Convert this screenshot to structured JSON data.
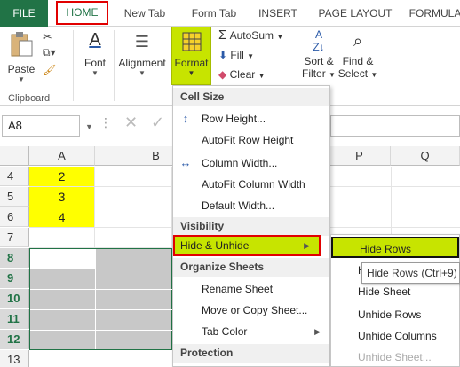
{
  "tabs": [
    "FILE",
    "HOME",
    "New Tab",
    "Form Tab",
    "INSERT",
    "PAGE LAYOUT",
    "FORMULA"
  ],
  "ribbon": {
    "paste": "Paste",
    "clipboard": "Clipboard",
    "font": "Font",
    "alignment": "Alignment",
    "format": "Format",
    "autosum": "AutoSum",
    "fill": "Fill",
    "clear": "Clear",
    "sort_filter_1": "Sort &",
    "sort_filter_2": "Filter",
    "find_select_1": "Find &",
    "find_select_2": "Select"
  },
  "namebox": "A8",
  "grid": {
    "columns": [
      "A",
      "B",
      "P",
      "Q"
    ],
    "rows": [
      "4",
      "5",
      "6",
      "7",
      "8",
      "9",
      "10",
      "11",
      "12",
      "13"
    ],
    "a_values": [
      "2",
      "3",
      "4"
    ]
  },
  "menu": {
    "sec_cell_size": "Cell Size",
    "row_height": "Row Height...",
    "autofit_row": "AutoFit Row Height",
    "col_width": "Column Width...",
    "autofit_col": "AutoFit Column Width",
    "default_width": "Default Width...",
    "sec_visibility": "Visibility",
    "hide_unhide": "Hide & Unhide",
    "sec_organize": "Organize Sheets",
    "rename_sheet": "Rename Sheet",
    "move_copy": "Move or Copy Sheet...",
    "tab_color": "Tab Color",
    "sec_protection": "Protection"
  },
  "submenu": {
    "hide_rows": "Hide Rows",
    "hide_columns_partial": "H",
    "hide_sheet": "Hide Sheet",
    "unhide_rows": "Unhide Rows",
    "unhide_columns": "Unhide Columns",
    "unhide_sheet": "Unhide Sheet..."
  },
  "tooltip": "Hide Rows (Ctrl+9)",
  "colors": {
    "excel_green": "#217346",
    "highlight_lime": "#c7e400",
    "highlight_red_border": "#e10000",
    "yellow_fill": "#ffff00",
    "selected_gray": "#c8c8c8"
  }
}
